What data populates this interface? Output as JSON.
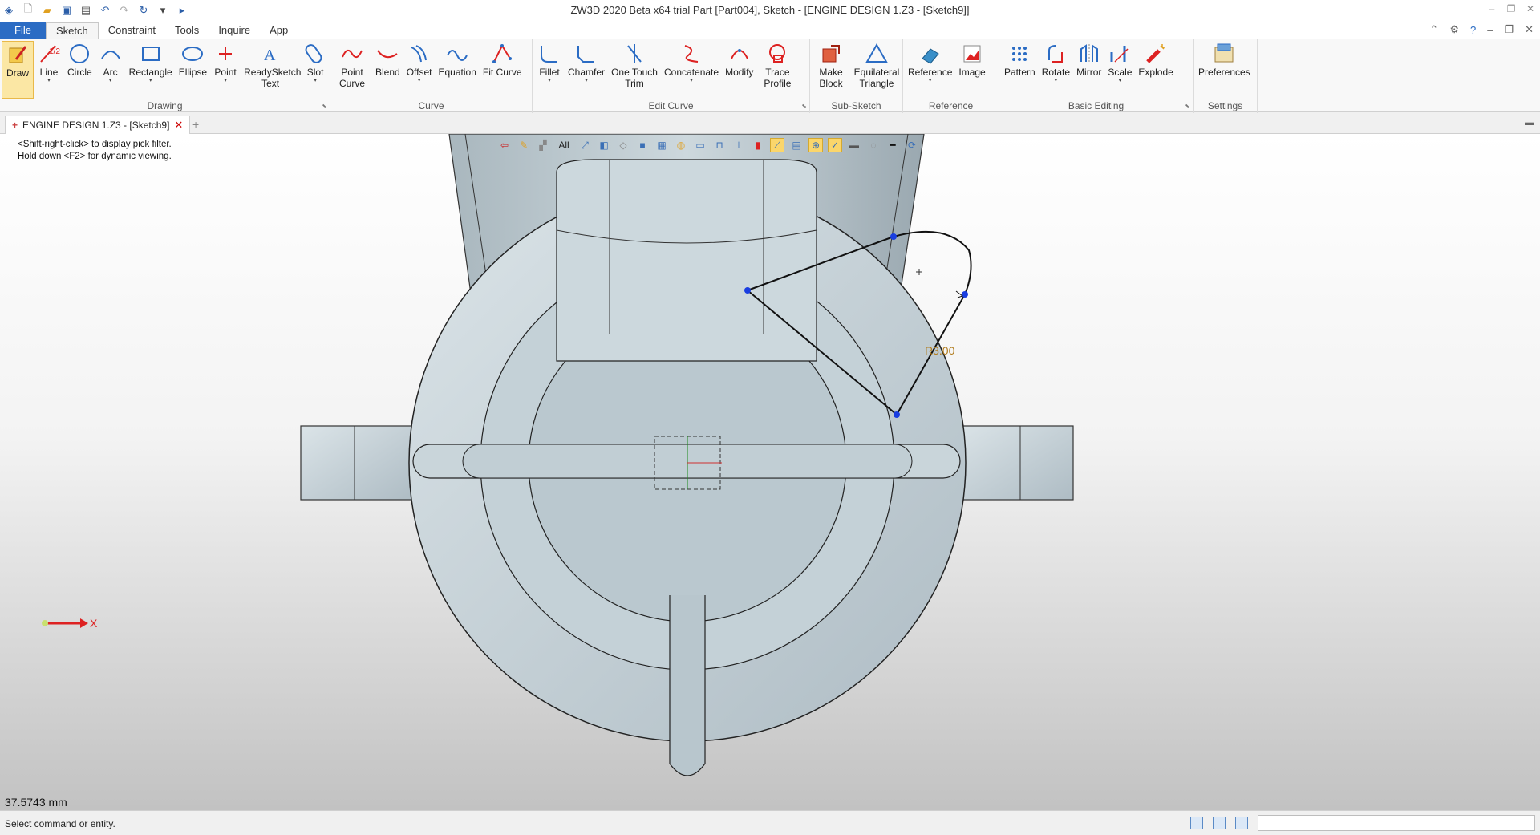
{
  "window": {
    "title": "ZW3D 2020 Beta x64 trial        Part [Part004],  Sketch - [ENGINE DESIGN 1.Z3 - [Sketch9]]"
  },
  "menu": {
    "file": "File",
    "tabs": [
      "Sketch",
      "Constraint",
      "Tools",
      "Inquire",
      "App"
    ]
  },
  "ribbon": {
    "groups": [
      {
        "label": "Drawing",
        "buttons": [
          "Draw",
          "Line",
          "Circle",
          "Arc",
          "Rectangle",
          "Ellipse",
          "Point",
          "ReadySketch Text",
          "Slot"
        ]
      },
      {
        "label": "Curve",
        "buttons": [
          "Point Curve",
          "Blend",
          "Offset",
          "Equation",
          "Fit Curve"
        ]
      },
      {
        "label": "Edit Curve",
        "buttons": [
          "Fillet",
          "Chamfer",
          "One Touch Trim",
          "Concatenate",
          "Modify",
          "Trace Profile"
        ]
      },
      {
        "label": "Sub-Sketch",
        "buttons": [
          "Make Block",
          "Equilateral Triangle"
        ]
      },
      {
        "label": "Reference",
        "buttons": [
          "Reference",
          "Image"
        ]
      },
      {
        "label": "Basic Editing",
        "buttons": [
          "Pattern",
          "Rotate",
          "Mirror",
          "Scale",
          "Explode"
        ]
      },
      {
        "label": "Settings",
        "buttons": [
          "Preferences"
        ]
      }
    ]
  },
  "doc_tab": {
    "label": "ENGINE DESIGN 1.Z3 - [Sketch9]"
  },
  "viewport": {
    "hint_line1": "<Shift-right-click> to display pick filter.",
    "hint_line2": "Hold down <F2> for dynamic viewing.",
    "filter_all": "All",
    "dimension_label": "R3.00",
    "axis_label": "X",
    "measurement": "37.5743 mm"
  },
  "status": {
    "message": "Select command or entity."
  },
  "colors": {
    "accent": "#2b6cc4",
    "sketch_point": "#1a3ee0",
    "dimension": "#b07a1a",
    "part_fill": "#c7d5dc"
  }
}
